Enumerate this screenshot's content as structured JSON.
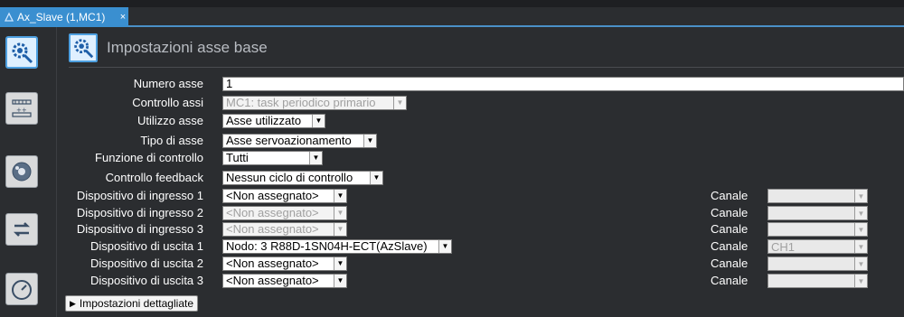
{
  "tab": {
    "title": "Ax_Slave (1,MC1)",
    "close": "×"
  },
  "header": {
    "title": "Impostazioni asse base"
  },
  "sidebar": [
    {
      "name": "axis-settings-icon",
      "active": true
    },
    {
      "name": "unit-conversion-icon",
      "active": false
    },
    {
      "name": "homing-icon",
      "active": false
    },
    {
      "name": "position-count-icon",
      "active": false
    },
    {
      "name": "servo-drive-icon",
      "active": false
    }
  ],
  "fields": {
    "numero_asse": {
      "label": "Numero asse",
      "value": "1"
    },
    "controllo_assi": {
      "label": "Controllo assi",
      "value": "MC1: task periodico primario"
    },
    "utilizzo_asse": {
      "label": "Utilizzo asse",
      "value": "Asse utilizzato"
    },
    "tipo_asse": {
      "label": "Tipo di asse",
      "value": "Asse servoazionamento"
    },
    "funzione_controllo": {
      "label": "Funzione di controllo",
      "value": "Tutti"
    },
    "controllo_feedback": {
      "label": "Controllo feedback",
      "value": "Nessun ciclo di controllo"
    },
    "ingresso_1": {
      "label": "Dispositivo di ingresso 1",
      "value": "<Non assegnato>"
    },
    "ingresso_2": {
      "label": "Dispositivo di ingresso 2",
      "value": "<Non assegnato>"
    },
    "ingresso_3": {
      "label": "Dispositivo di ingresso 3",
      "value": "<Non assegnato>"
    },
    "uscita_1": {
      "label": "Dispositivo di uscita 1",
      "value": "Nodo: 3 R88D-1SN04H-ECT(AzSlave)"
    },
    "uscita_2": {
      "label": "Dispositivo di uscita 2",
      "value": "<Non assegnato>"
    },
    "uscita_3": {
      "label": "Dispositivo di uscita 3",
      "value": "<Non assegnato>"
    }
  },
  "canale": {
    "label": "Canale",
    "values": [
      "",
      "",
      "",
      "CH1",
      "",
      ""
    ]
  },
  "detail_button": {
    "label": "Impostazioni dettagliate"
  },
  "dropdown_arrow": "▼",
  "colors": {
    "accent": "#3a8fd0",
    "background": "#2b2d30"
  }
}
